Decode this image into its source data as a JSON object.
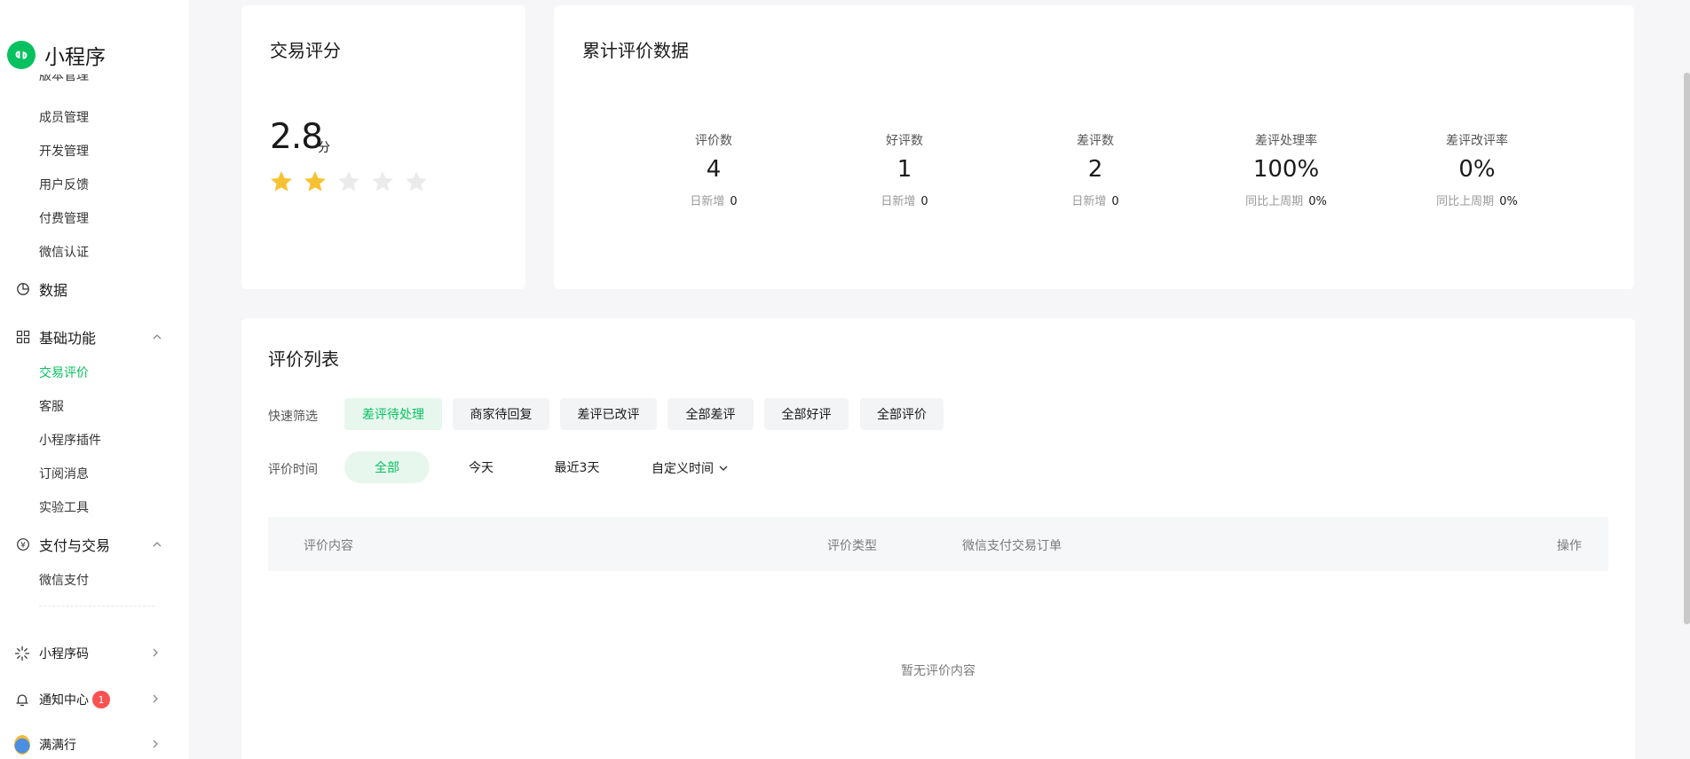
{
  "app": {
    "brand_name": "小程序"
  },
  "sidebar": {
    "cut_item": "版本管理",
    "management_items": [
      "成员管理",
      "开发管理",
      "用户反馈",
      "付费管理",
      "微信认证"
    ],
    "data_group": "数据",
    "basic_group": "基础功能",
    "basic_items": [
      "交易评价",
      "客服",
      "小程序插件",
      "订阅消息",
      "实验工具"
    ],
    "pay_group": "支付与交易",
    "pay_items": [
      "微信支付"
    ],
    "footer": {
      "qrcode_label": "小程序码",
      "notice_label": "通知中心",
      "notice_badge": "1",
      "account_label": "满满行"
    }
  },
  "score_card": {
    "title": "交易评分",
    "score": "2.8",
    "unit": "分",
    "stars_filled": 2,
    "stars_total": 5,
    "star_color": "#f7c232",
    "star_empty_color": "#ebebeb"
  },
  "stats_card": {
    "title": "累计评价数据",
    "items": [
      {
        "label": "评价数",
        "value": "4",
        "sub_label": "日新增",
        "sub_value": "0"
      },
      {
        "label": "好评数",
        "value": "1",
        "sub_label": "日新增",
        "sub_value": "0"
      },
      {
        "label": "差评数",
        "value": "2",
        "sub_label": "日新增",
        "sub_value": "0"
      },
      {
        "label": "差评处理率",
        "value": "100%",
        "sub_label": "同比上周期",
        "sub_value": "0%"
      },
      {
        "label": "差评改评率",
        "value": "0%",
        "sub_label": "同比上周期",
        "sub_value": "0%"
      }
    ]
  },
  "reviews": {
    "title": "评价列表",
    "quick_filter_label": "快速筛选",
    "quick_filters": [
      "差评待处理",
      "商家待回复",
      "差评已改评",
      "全部差评",
      "全部好评",
      "全部评价"
    ],
    "active_quick_filter": 0,
    "time_label": "评价时间",
    "time_filters": [
      "全部",
      "今天",
      "最近3天"
    ],
    "active_time_filter": 0,
    "custom_time_label": "自定义时间",
    "columns": [
      "评价内容",
      "评价类型",
      "微信支付交易订单",
      "操作"
    ],
    "empty_text": "暂无评价内容"
  },
  "colors": {
    "accent": "#07c160",
    "badge": "#fa5151"
  }
}
